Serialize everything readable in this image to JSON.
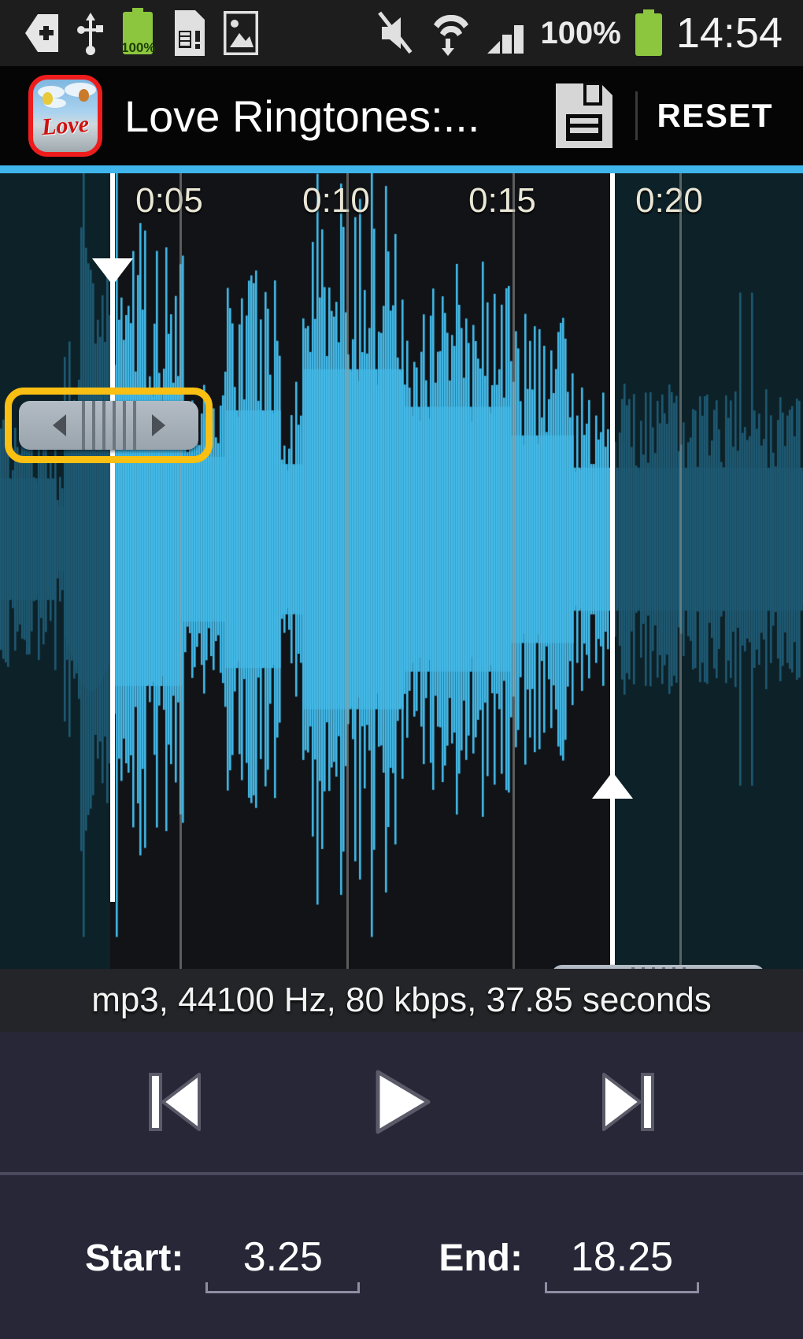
{
  "statusbar": {
    "time": "14:54",
    "battery_percent": "100%",
    "battery_badge": "100%",
    "icons": [
      "back-arrow-icon",
      "usb-icon",
      "battery-charging-icon",
      "sim-card-alert-icon",
      "image-icon",
      "mute-icon",
      "wifi-data-icon",
      "signal-bars-icon",
      "battery-icon"
    ]
  },
  "appbar": {
    "title": "Love Ringtones:...",
    "app_icon_word": "Love",
    "save_icon": "floppy-disk-save-icon",
    "reset_label": "RESET"
  },
  "waveform": {
    "ruler_labels": [
      "0:05",
      "0:10",
      "0:15",
      "0:20"
    ],
    "accent_color": "#3fb5ec",
    "selected_wave_color": "#44bbea",
    "unselected_wave_color": "#1e5a73",
    "selected_bg_color": "#111317",
    "unselected_bg_color": "#0d2128",
    "handle_focus_color": "#f9bf12",
    "start_handle": "start-trim-handle",
    "end_handle": "end-trim-handle"
  },
  "info": {
    "text": "mp3, 44100 Hz, 80 kbps, 37.85 seconds",
    "format": "mp3",
    "sample_rate": "44100 Hz",
    "bitrate": "80 kbps",
    "duration": "37.85 seconds"
  },
  "transport": {
    "rewind_label": "previous-track",
    "play_label": "play",
    "forward_label": "next-track"
  },
  "marks": {
    "start_label": "Start:",
    "start_value": "3.25",
    "end_label": "End:",
    "end_value": "18.25"
  }
}
